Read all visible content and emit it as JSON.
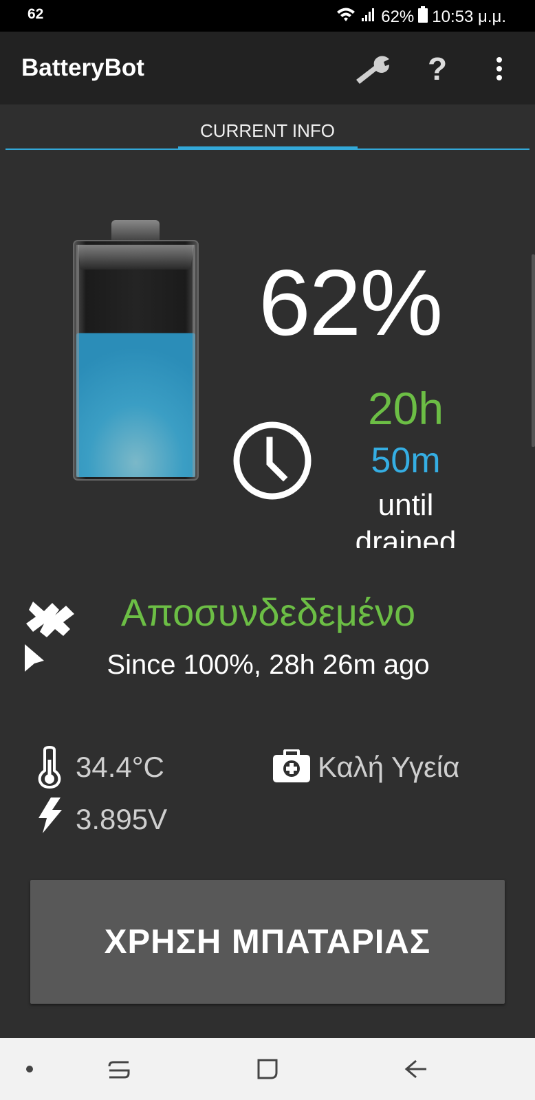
{
  "status_bar": {
    "notification_count": "62",
    "battery_percent": "62%",
    "time": "10:53 μ.μ.",
    "icons": [
      "wifi-icon",
      "signal-icon",
      "battery-icon"
    ]
  },
  "app_bar": {
    "title": "BatteryBot",
    "icons": [
      "wrench-icon",
      "help-icon",
      "more-vert-icon"
    ]
  },
  "tabs": [
    {
      "label": "CURRENT INFO",
      "selected": true
    }
  ],
  "battery": {
    "level_percent": 62,
    "percent_label": "62%",
    "fill_color": "#3aa0c9"
  },
  "time_left": {
    "hours": "20h",
    "minutes": "50m",
    "until": "until",
    "drained": "drained"
  },
  "connection": {
    "status": "Αποσυνδεδεμένο",
    "since": "Since 100%, 28h 26m ago"
  },
  "stats": {
    "temperature": "34.4°C",
    "voltage": "3.895V",
    "health": "Καλή Υγεία"
  },
  "usage_button": {
    "label": "ΧΡΗΣΗ ΜΠΑΤΑΡΙΑΣ"
  },
  "nav_bar": {
    "icons": [
      "dot-icon",
      "recent-apps-icon",
      "home-icon",
      "back-icon"
    ]
  },
  "colors": {
    "green": "#6cbe45",
    "blue": "#35aee3",
    "accent_tab": "#33a8d8",
    "background": "#2f2f2f"
  }
}
